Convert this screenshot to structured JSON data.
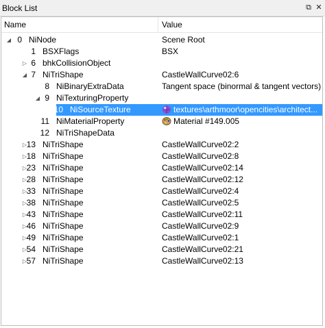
{
  "window": {
    "title": "Block List",
    "float_icon": "float-icon",
    "close_icon": "close-icon"
  },
  "columns": {
    "name": "Name",
    "value": "Value"
  },
  "rows": [
    {
      "idx": "0",
      "name": "NiNode",
      "value": "Scene Root",
      "expander": "open",
      "level": 0
    },
    {
      "idx": "1",
      "name": "BSXFlags",
      "value": "BSX",
      "expander": "none",
      "level": 1
    },
    {
      "idx": "6",
      "name": "bhkCollisionObject",
      "value": "",
      "expander": "closed",
      "level": 1
    },
    {
      "idx": "7",
      "name": "NiTriShape",
      "value": "CastleWallCurve02:6",
      "expander": "open",
      "level": 1
    },
    {
      "idx": "8",
      "name": "NiBinaryExtraData",
      "value": "Tangent space (binormal & tangent vectors)",
      "expander": "none",
      "level": 2
    },
    {
      "idx": "9",
      "name": "NiTexturingProperty",
      "value": "",
      "expander": "open",
      "level": 2
    },
    {
      "idx": "10",
      "name": "NiSourceTexture",
      "value": "textures\\arthmoor\\opencities\\architect...",
      "expander": "none",
      "level": 3,
      "selected": true,
      "icon": "texture-icon"
    },
    {
      "idx": "11",
      "name": "NiMaterialProperty",
      "value": "Material #149.005",
      "expander": "none",
      "level": 2,
      "icon": "material-palette-icon"
    },
    {
      "idx": "12",
      "name": "NiTriShapeData",
      "value": "",
      "expander": "none",
      "level": 2
    },
    {
      "idx": "13",
      "name": "NiTriShape",
      "value": "CastleWallCurve02:2",
      "expander": "closed",
      "level": 1
    },
    {
      "idx": "18",
      "name": "NiTriShape",
      "value": "CastleWallCurve02:8",
      "expander": "closed",
      "level": 1
    },
    {
      "idx": "23",
      "name": "NiTriShape",
      "value": "CastleWallCurve02:14",
      "expander": "closed",
      "level": 1
    },
    {
      "idx": "28",
      "name": "NiTriShape",
      "value": "CastleWallCurve02:12",
      "expander": "closed",
      "level": 1
    },
    {
      "idx": "33",
      "name": "NiTriShape",
      "value": "CastleWallCurve02:4",
      "expander": "closed",
      "level": 1
    },
    {
      "idx": "38",
      "name": "NiTriShape",
      "value": "CastleWallCurve02:5",
      "expander": "closed",
      "level": 1
    },
    {
      "idx": "43",
      "name": "NiTriShape",
      "value": "CastleWallCurve02:11",
      "expander": "closed",
      "level": 1
    },
    {
      "idx": "46",
      "name": "NiTriShape",
      "value": "CastleWallCurve02:9",
      "expander": "closed",
      "level": 1
    },
    {
      "idx": "49",
      "name": "NiTriShape",
      "value": "CastleWallCurve02:1",
      "expander": "closed",
      "level": 1
    },
    {
      "idx": "54",
      "name": "NiTriShape",
      "value": "CastleWallCurve02:21",
      "expander": "closed",
      "level": 1
    },
    {
      "idx": "57",
      "name": "NiTriShape",
      "value": "CastleWallCurve02:13",
      "expander": "closed",
      "level": 1
    }
  ],
  "colors": {
    "selection": "#3399ff",
    "titlebar": "#f0f0f0"
  }
}
